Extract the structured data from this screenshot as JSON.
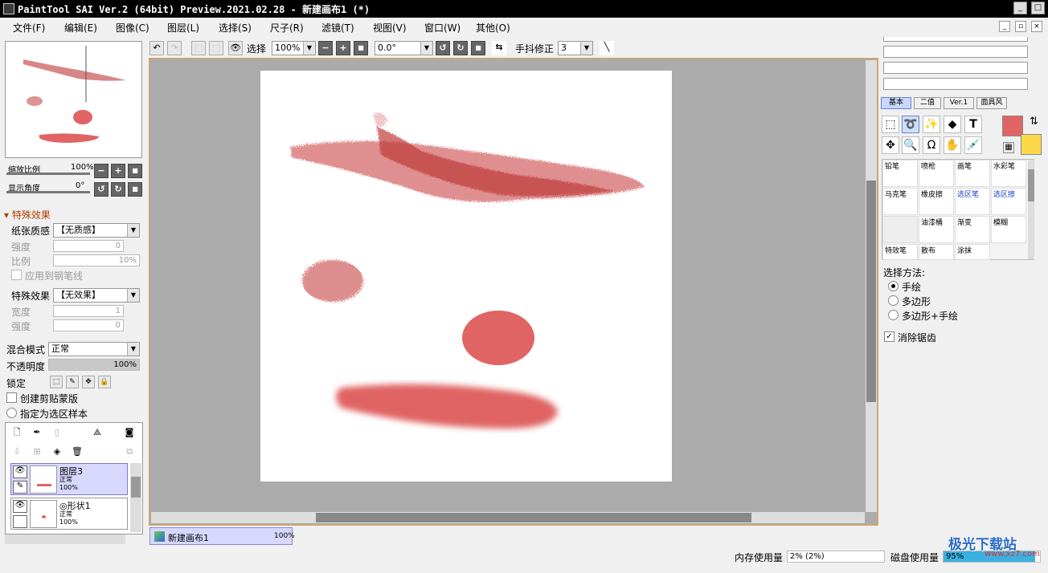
{
  "title": "PaintTool SAI Ver.2 (64bit) Preview.2021.02.28 - 新建画布1 (*)",
  "menu": [
    "文件(F)",
    "编辑(E)",
    "图像(C)",
    "图层(L)",
    "选择(S)",
    "尺子(R)",
    "滤镜(T)",
    "视图(V)",
    "窗口(W)",
    "其他(O)"
  ],
  "toolbar": {
    "select_label": "选择",
    "zoom": "100%",
    "angle": "0.0°",
    "stabilizer_label": "手抖修正",
    "stabilizer": "3"
  },
  "navigator": {
    "zoom_label": "缩放比例",
    "zoom_value": "100%",
    "angle_label": "显示角度",
    "angle_value": "0°"
  },
  "effects": {
    "header": "特殊效果",
    "paper_label": "纸张质感",
    "paper_value": "【无质感】",
    "strength_label": "强度",
    "strength_value": "0",
    "scale_label": "比例",
    "scale_value": "10%",
    "apply_pen_label": "应用到钢笔线",
    "effect_label": "特殊效果",
    "effect_value": "【无效果】",
    "width_label": "宽度",
    "width_value": "1",
    "strength2_label": "强度",
    "strength2_value": "0"
  },
  "layer_props": {
    "blend_label": "混合模式",
    "blend_value": "正常",
    "opacity_label": "不透明度",
    "opacity_value": "100%",
    "lock_label": "锁定",
    "clip_label": "创建剪贴蒙版",
    "sample_label": "指定为选区样本"
  },
  "layers": [
    {
      "name": "图层3",
      "mode": "正常",
      "opacity": "100%"
    },
    {
      "name": "形状1",
      "mode": "正常",
      "opacity": "100%"
    }
  ],
  "doc_tab": {
    "name": "新建画布1",
    "zoom": "100%"
  },
  "right": {
    "tabs": [
      "基本",
      "二值",
      "Ver.1",
      "面具风"
    ],
    "brushes": [
      "铅笔",
      "喷枪",
      "画笔",
      "水彩笔",
      "马克笔",
      "橡皮擦",
      "选区笔",
      "选区擦",
      "",
      "油漆桶",
      "渐变",
      "模糊",
      "特效笔",
      "散布",
      "涂抹",
      ""
    ],
    "select_method_label": "选择方法:",
    "methods": [
      "手绘",
      "多边形",
      "多边形+手绘"
    ],
    "antialias_label": "消除锯齿"
  },
  "colors": {
    "primary": "#e06464",
    "secondary": "#ffd84a",
    "accent": "#f0a040"
  },
  "status": {
    "memory_label": "内存使用量",
    "memory_value": "2% (2%)",
    "disk_label": "磁盘使用量",
    "disk_value": "95%"
  },
  "watermark": {
    "text": "极光下载站",
    "url": "www.xz7.com"
  }
}
